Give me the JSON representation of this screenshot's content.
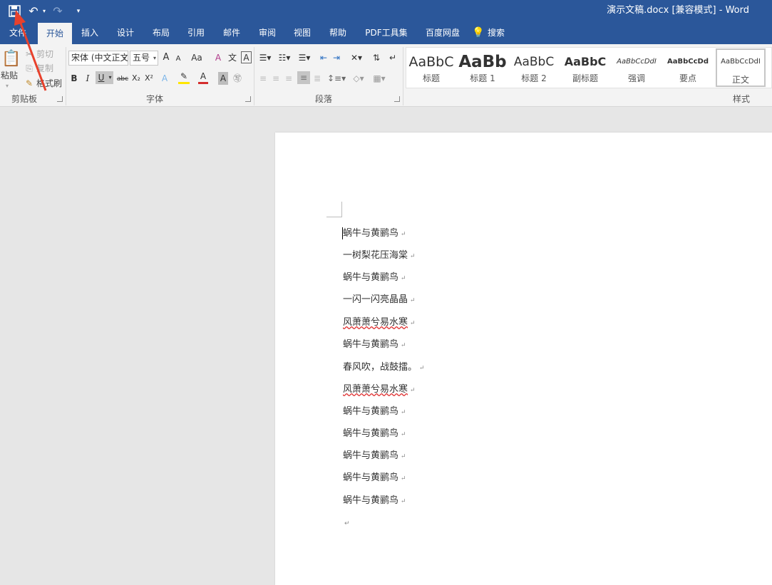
{
  "titlebar": {
    "doc_title": "演示文稿.docx [兼容模式]  -  Word",
    "save_icon": "save-icon",
    "undo_icon": "undo-icon",
    "redo_icon": "redo-icon",
    "customize_icon": "customize-qat-icon",
    "background": "#2b579a"
  },
  "tabs": {
    "file": "文件",
    "home": "开始",
    "insert": "插入",
    "design": "设计",
    "layout": "布局",
    "references": "引用",
    "mailings": "邮件",
    "review": "审阅",
    "view": "视图",
    "help": "帮助",
    "pdf": "PDF工具集",
    "baidu": "百度网盘",
    "search": "搜索"
  },
  "clipboard": {
    "paste": "粘贴",
    "cut": "剪切",
    "copy": "复制",
    "format_painter": "格式刷",
    "group_label": "剪贴板"
  },
  "font": {
    "font_name": "宋体 (中文正文)",
    "font_size": "五号",
    "grow": "A",
    "shrink": "A",
    "change_case": "Aa",
    "bold": "B",
    "italic": "I",
    "underline": "U",
    "strike": "abc",
    "subscript": "X₂",
    "superscript": "X²",
    "text_effect": "A",
    "font_color": "A",
    "char_shading": "A",
    "group_label": "字体"
  },
  "paragraph": {
    "group_label": "段落"
  },
  "styles": {
    "items": [
      {
        "preview": "AaBbC",
        "name": "标题"
      },
      {
        "preview": "AaBb",
        "name": "标题 1"
      },
      {
        "preview": "AaBbC",
        "name": "标题 2"
      },
      {
        "preview": "AaBbC",
        "name": "副标题"
      },
      {
        "preview": "AaBbCcDdI",
        "name": "强调"
      },
      {
        "preview": "AaBbCcDd",
        "name": "要点"
      },
      {
        "preview": "AaBbCcDdI",
        "name": "正文"
      }
    ],
    "group_label": "样式"
  },
  "document": {
    "lines": [
      "蜗牛与黄鹂鸟",
      "一树梨花压海棠",
      "蜗牛与黄鹂鸟",
      "一闪一闪亮晶晶",
      "风萧萧兮易水寒",
      "蜗牛与黄鹂鸟",
      "春风吹，战鼓擂。",
      "风萧萧兮易水寒",
      "蜗牛与黄鹂鸟",
      "蜗牛与黄鹂鸟",
      "蜗牛与黄鹂鸟",
      "蜗牛与黄鹂鸟",
      "蜗牛与黄鹂鸟"
    ],
    "paragraph_mark": "↵"
  },
  "annotation": {
    "color": "#e8412c"
  }
}
